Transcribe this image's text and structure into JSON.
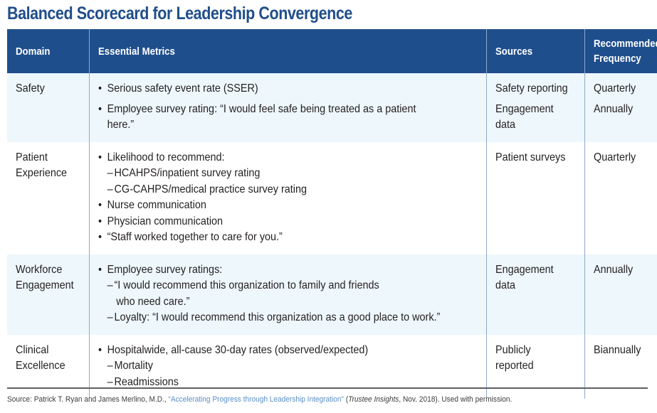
{
  "title": "Balanced Scorecard for Leadership Convergence",
  "colors": {
    "header_bg": "#1f4e8c",
    "shaded_row": "#eef7fc",
    "link": "#5b8fc7"
  },
  "table": {
    "headers": [
      "Domain",
      "Essential Metrics",
      "Sources",
      "Recommended Frequency"
    ],
    "rows": [
      {
        "domain": "Safety",
        "metrics": [
          {
            "type": "bullet",
            "text": "Serious safety event rate (SSER)"
          },
          {
            "type": "bullet",
            "text": "Employee survey rating: “I would feel safe being treated as a patient",
            "cont": "here.”"
          }
        ],
        "sources": [
          "Safety reporting",
          "Engagement",
          "data"
        ],
        "frequency": [
          "Quarterly",
          "Annually"
        ]
      },
      {
        "domain": [
          "Patient",
          "Experience"
        ],
        "metrics": [
          {
            "type": "bullet",
            "text": "Likelihood to recommend:"
          },
          {
            "type": "sub",
            "text": "HCAHPS/inpatient survey rating"
          },
          {
            "type": "sub",
            "text": "CG-CAHPS/medical practice survey rating"
          },
          {
            "type": "bullet",
            "text": "Nurse communication"
          },
          {
            "type": "bullet",
            "text": "Physician communication"
          },
          {
            "type": "bullet",
            "text": "“Staff worked together to care for you.”"
          }
        ],
        "sources": [
          "Patient surveys"
        ],
        "frequency": [
          "Quarterly"
        ]
      },
      {
        "domain": [
          "Workforce",
          "Engagement"
        ],
        "metrics": [
          {
            "type": "bullet",
            "text": "Employee survey ratings:"
          },
          {
            "type": "sub",
            "text": "“I would recommend this organization to family and friends",
            "cont": "who need care.”"
          },
          {
            "type": "sub",
            "text": "Loyalty: “I would recommend this organization as a good place to work.”"
          }
        ],
        "sources": [
          "Engagement",
          "data"
        ],
        "frequency": [
          "Annually"
        ]
      },
      {
        "domain": [
          "Clinical",
          "Excellence"
        ],
        "metrics": [
          {
            "type": "bullet",
            "text": "Hospitalwide, all-cause 30-day rates (observed/expected)"
          },
          {
            "type": "sub",
            "text": "Mortality"
          },
          {
            "type": "sub",
            "text": "Readmissions"
          }
        ],
        "sources": [
          "Publicly",
          "reported"
        ],
        "frequency": [
          "Biannually"
        ]
      }
    ]
  },
  "footnote": {
    "prefix": "Source: Patrick T. Ryan and James Merlino, M.D., ",
    "link_text": "“Accelerating Progress through Leadership Integration”",
    "middle": " (",
    "publication": "Trustee Insights",
    "suffix": ", Nov. 2018). Used with permission."
  }
}
